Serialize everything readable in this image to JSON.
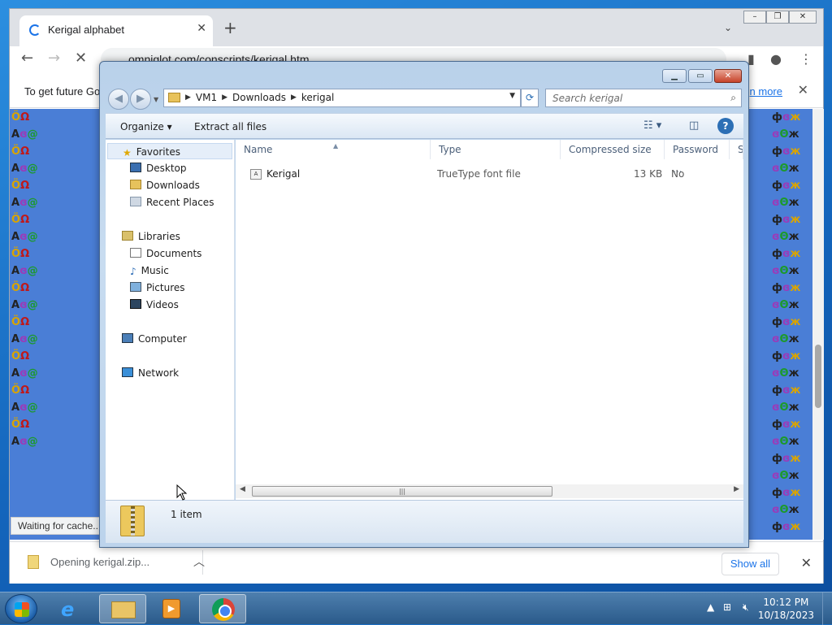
{
  "browser": {
    "tab_title": "Kerigal alphabet",
    "url": "omniglot.com/conscripts/kerigal.htm",
    "infobar_text": "To get future Go",
    "infobar_link": "n more",
    "status_text": "Waiting for cache...",
    "download_label": "Opening kerigal.zip...",
    "show_all_label": "Show all"
  },
  "explorer": {
    "breadcrumbs": [
      "VM1",
      "Downloads",
      "kerigal"
    ],
    "search_placeholder": "Search kerigal",
    "toolbar": {
      "organize": "Organize",
      "extract": "Extract all files"
    },
    "nav": {
      "favorites": "Favorites",
      "desktop": "Desktop",
      "downloads": "Downloads",
      "recent": "Recent Places",
      "libraries": "Libraries",
      "documents": "Documents",
      "music": "Music",
      "pictures": "Pictures",
      "videos": "Videos",
      "computer": "Computer",
      "network": "Network"
    },
    "columns": {
      "name": "Name",
      "type": "Type",
      "compressed": "Compressed size",
      "password": "Password ...",
      "size": "Si"
    },
    "files": [
      {
        "name": "Kerigal",
        "type": "TrueType font file",
        "compressed": "13 KB",
        "password": "No"
      }
    ],
    "item_count": "1 item"
  },
  "taskbar": {
    "time": "10:12 PM",
    "date": "10/18/2023"
  },
  "colors": {
    "accent": "#1a73e8",
    "desktop": "#1a6fc4"
  }
}
